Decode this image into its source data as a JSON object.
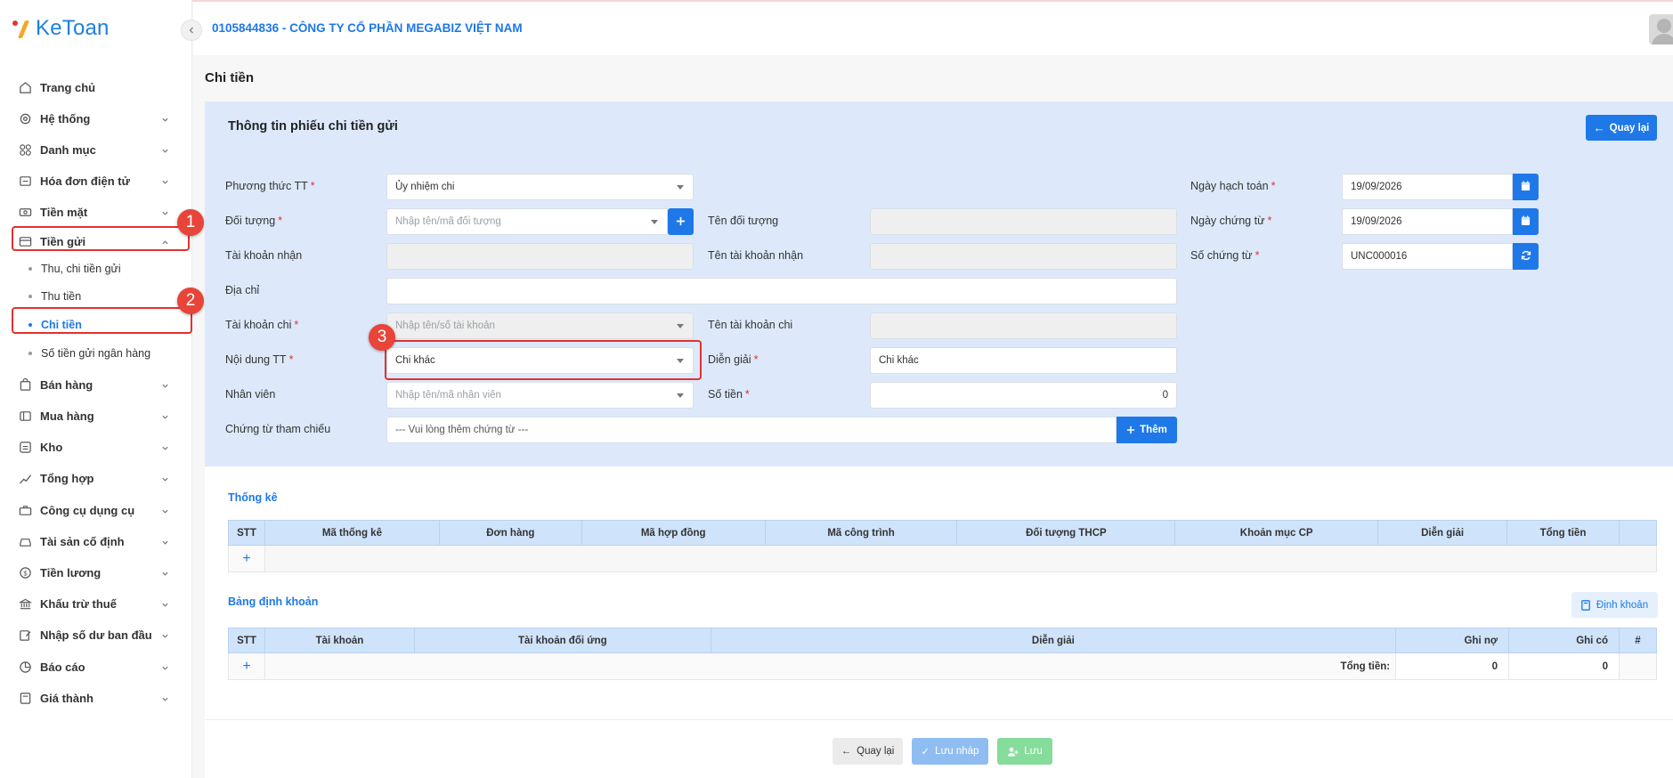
{
  "app": {
    "logo_text": "KeToan"
  },
  "header": {
    "company": "0105844836 - CÔNG TY CỔ PHẦN MEGABIZ VIỆT NAM"
  },
  "sidebar": {
    "items": [
      {
        "label": "Trang chủ",
        "icon": "home-icon"
      },
      {
        "label": "Hệ thống",
        "icon": "gear-icon"
      },
      {
        "label": "Danh mục",
        "icon": "grid-icon"
      },
      {
        "label": "Hóa đơn điện tử",
        "icon": "invoice-icon"
      },
      {
        "label": "Tiền mặt",
        "icon": "cash-icon"
      },
      {
        "label": "Tiền gửi",
        "icon": "card-icon"
      },
      {
        "label": "Bán hàng",
        "icon": "sale-icon"
      },
      {
        "label": "Mua hàng",
        "icon": "cart-icon"
      },
      {
        "label": "Kho",
        "icon": "warehouse-icon"
      },
      {
        "label": "Tổng hợp",
        "icon": "chart-icon"
      },
      {
        "label": "Công cụ dụng cụ",
        "icon": "tools-icon"
      },
      {
        "label": "Tài sản cố định",
        "icon": "car-icon"
      },
      {
        "label": "Tiền lương",
        "icon": "dollar-icon"
      },
      {
        "label": "Khấu trừ thuế",
        "icon": "bank-icon"
      },
      {
        "label": "Nhập số dư ban đầu",
        "icon": "edit-icon"
      },
      {
        "label": "Báo cáo",
        "icon": "report-icon"
      },
      {
        "label": "Giá thành",
        "icon": "calculator-icon"
      }
    ],
    "subitems": [
      {
        "label": "Thu, chi tiền gửi"
      },
      {
        "label": "Thu tiền"
      },
      {
        "label": "Chi tiền"
      },
      {
        "label": "Số tiền gửi ngân hàng"
      }
    ]
  },
  "annotations": [
    "1",
    "2",
    "3"
  ],
  "page": {
    "title": "Chi tiền"
  },
  "form": {
    "title": "Thông tin phiếu chi tiền gửi",
    "back_label": "Quay lại",
    "labels": {
      "phuong_thuc": "Phương thức TT",
      "doi_tuong": "Đối tượng",
      "tai_khoan_nhan": "Tài khoản nhận",
      "dia_chi": "Địa chỉ",
      "tai_khoan_chi": "Tài khoản chi",
      "noi_dung": "Nội dung TT",
      "nhan_vien": "Nhân viên",
      "chung_tu": "Chứng từ tham chiếu",
      "ten_doi_tuong": "Tên đối tượng",
      "ten_tk_nhan": "Tên tài khoản nhận",
      "ten_tk_chi": "Tên tài khoản chi",
      "dien_giai": "Diễn giải",
      "so_tien": "Số tiền",
      "ngay_hach_toan": "Ngày hạch toán",
      "ngay_chung_tu": "Ngày chứng từ",
      "so_chung_tu": "Số chứng từ"
    },
    "values": {
      "phuong_thuc": "Ủy nhiệm chi",
      "doi_tuong_placeholder": "Nhập tên/mã đối tượng",
      "tai_khoan_chi_placeholder": "Nhập tên/số tài khoản",
      "noi_dung": "Chi khác",
      "nhan_vien_placeholder": "Nhập tên/mã nhân viên",
      "chung_tu_placeholder": "--- Vui lòng thêm chứng từ ---",
      "dien_giai": "Chi khác",
      "so_tien": "0",
      "ngay_hach_toan": "19/09/2026",
      "ngay_chung_tu": "19/09/2026",
      "so_chung_tu": "UNC000016"
    },
    "add_label": "Thêm"
  },
  "thong_ke": {
    "title": "Thống kê",
    "columns": [
      "STT",
      "Mã thống kê",
      "Đơn hàng",
      "Mã hợp đồng",
      "Mã công trình",
      "Đối tượng THCP",
      "Khoản mục CP",
      "Diễn giải",
      "Tổng tiền"
    ]
  },
  "dinh_khoan": {
    "title": "Bảng định khoản",
    "button": "Định khoản",
    "columns": [
      "STT",
      "Tài khoản",
      "Tài khoản đối ứng",
      "Diễn giải",
      "Ghi nợ",
      "Ghi có",
      "#"
    ],
    "total_label": "Tổng tiền:",
    "total_no": "0",
    "total_co": "0"
  },
  "footer": {
    "back": "Quay lại",
    "save_draft": "Lưu nháp",
    "save": "Lưu"
  },
  "colors": {
    "primary": "#1e78e8",
    "panel": "#dde9fb",
    "annotation": "#e03131",
    "save": "#86dc9a"
  }
}
